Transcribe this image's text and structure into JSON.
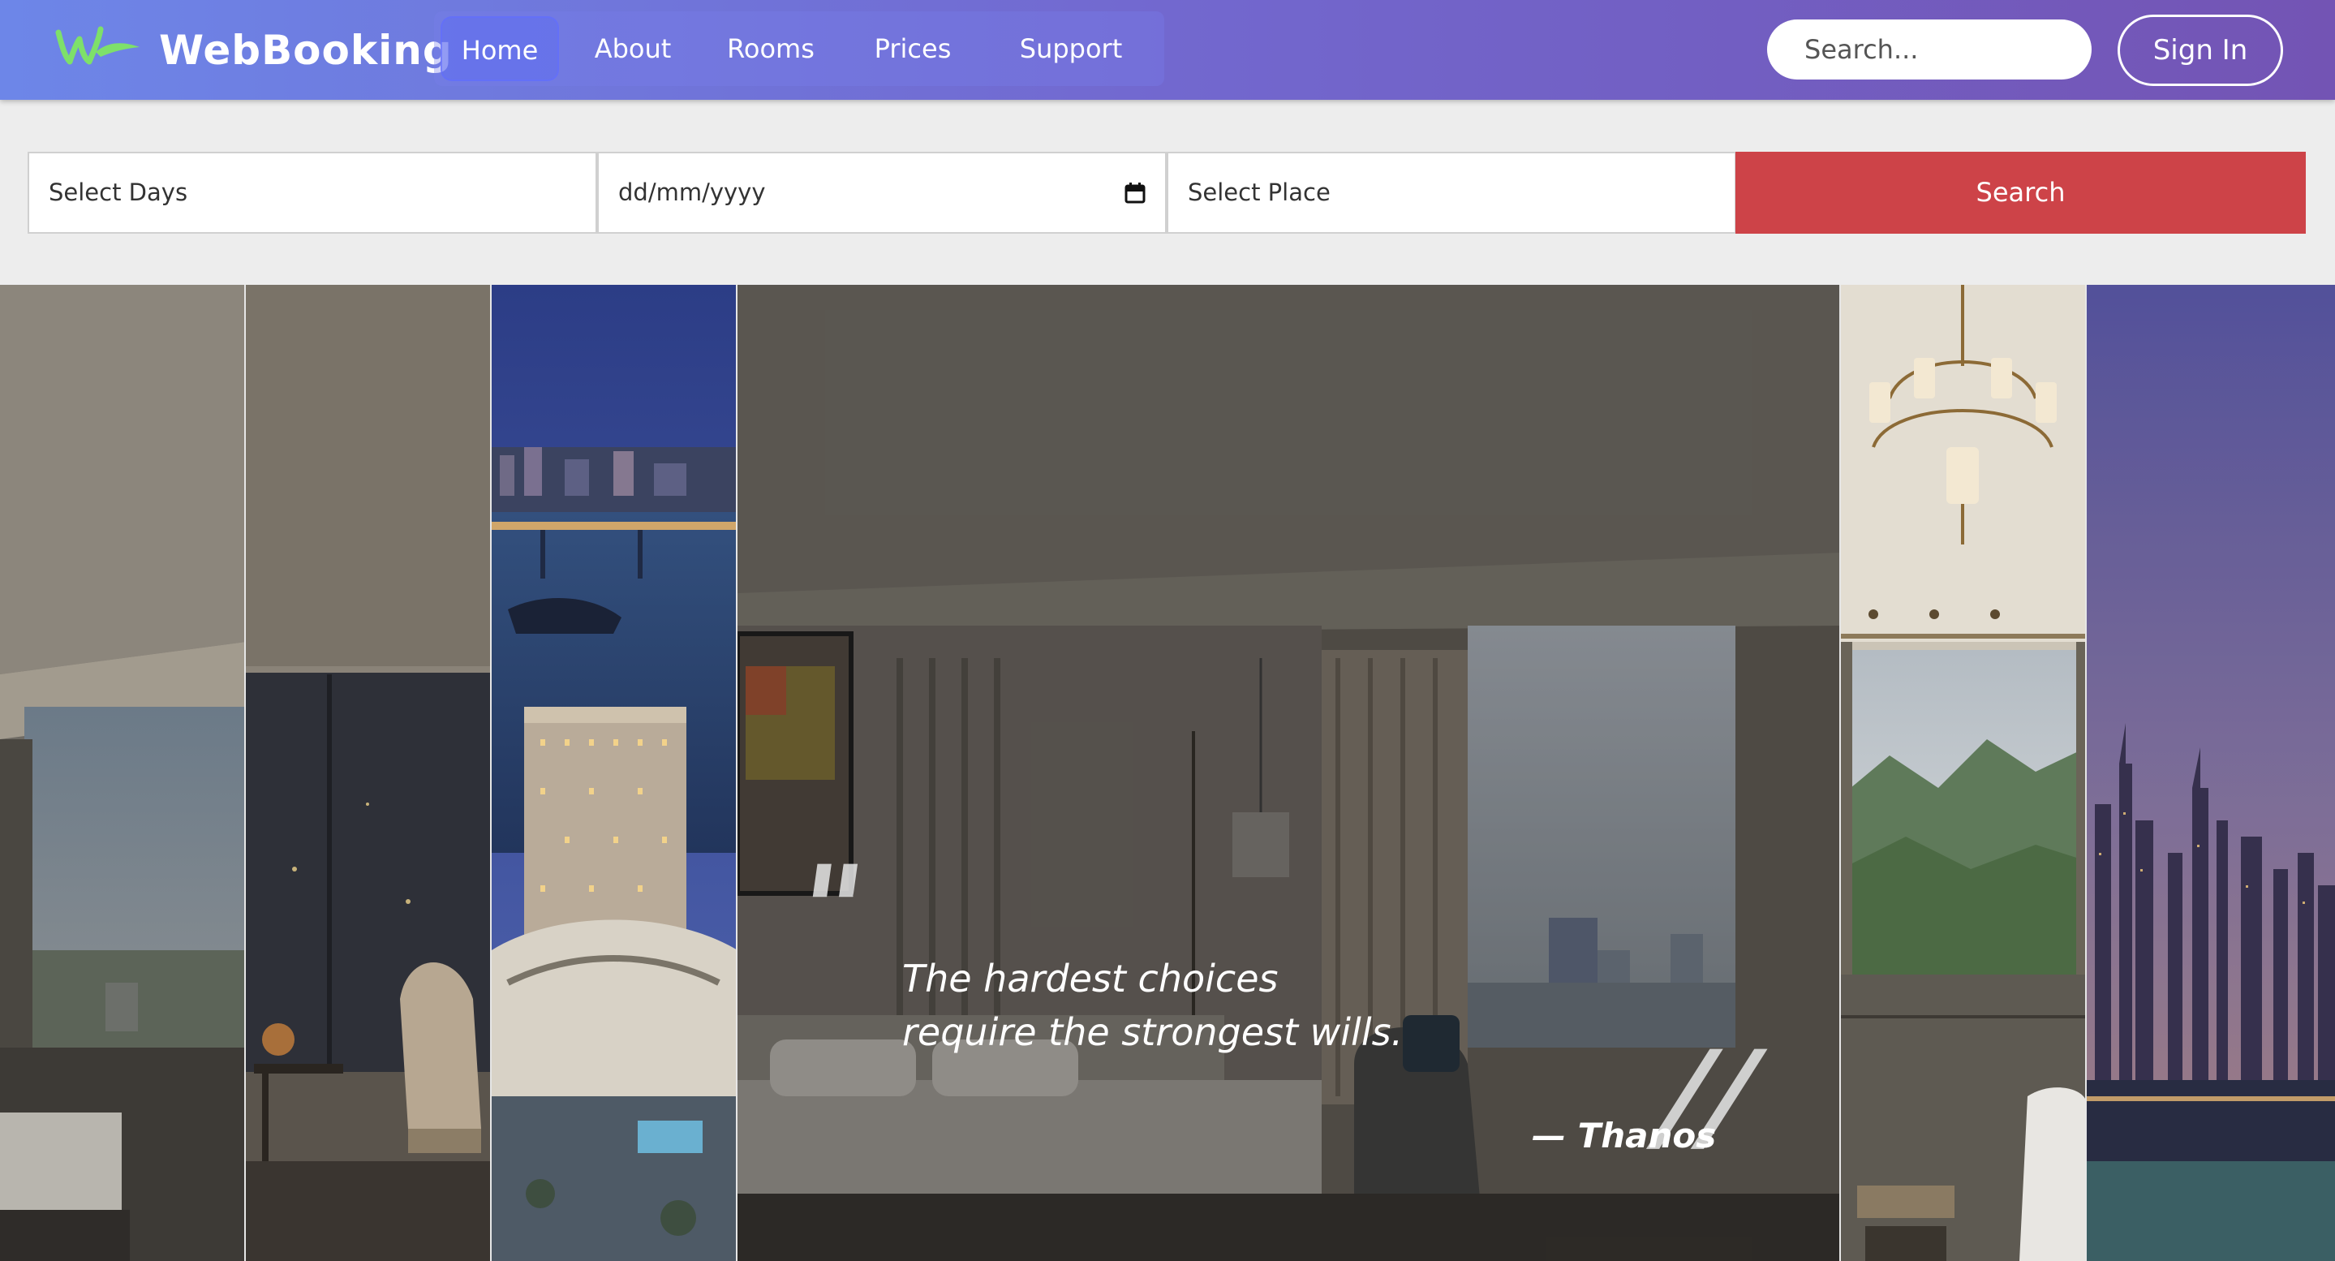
{
  "navbar": {
    "brand": "WebBooking",
    "links": [
      {
        "label": "Home",
        "active": true
      },
      {
        "label": "About",
        "active": false
      },
      {
        "label": "Rooms",
        "active": false
      },
      {
        "label": "Prices",
        "active": false
      },
      {
        "label": "Support",
        "active": false
      }
    ],
    "search_placeholder": "Search...",
    "sign_in_label": "Sign In",
    "logo_icon": "leaf-w-logo-icon"
  },
  "booking": {
    "days_placeholder": "Select Days",
    "date_placeholder": "dd/mm/yyyy",
    "place_placeholder": "Select Place",
    "search_label": "Search",
    "calendar_icon": "calendar-icon"
  },
  "gallery": {
    "panels": [
      {
        "scene": "hotel room with window"
      },
      {
        "scene": "room with office chair at night"
      },
      {
        "scene": "city bridge and harbor at dusk"
      },
      {
        "scene": "featured hotel bedroom with city view"
      },
      {
        "scene": "chandelier and mountain view"
      },
      {
        "scene": "city skyline at dusk"
      }
    ],
    "quote": {
      "open_mark": "\"",
      "line1": "The hardest choices",
      "line2": "require the strongest wills.",
      "close_mark": "//",
      "author": "— Thanos"
    }
  },
  "colors": {
    "nav_gradient_start": "#6d86e8",
    "nav_gradient_end": "#7354b4",
    "search_button": "#cd4348",
    "logo_green": "#7ee06a",
    "page_background": "#ededed"
  }
}
